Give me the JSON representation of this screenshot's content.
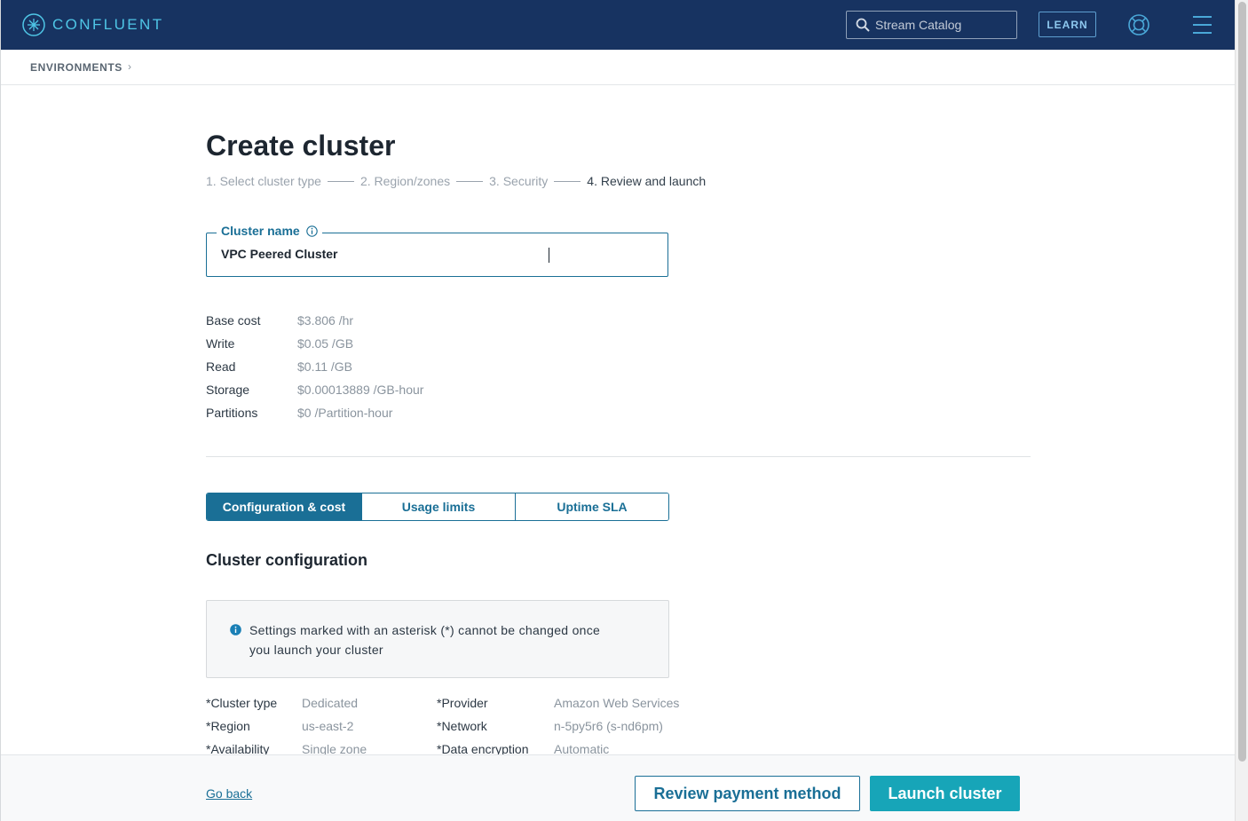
{
  "header": {
    "brand": "CONFLUENT",
    "search_placeholder": "Stream Catalog",
    "learn_label": "LEARN"
  },
  "breadcrumb": {
    "items": [
      "ENVIRONMENTS"
    ]
  },
  "page": {
    "title": "Create cluster",
    "steps": [
      {
        "label": "1. Select cluster type",
        "active": false
      },
      {
        "label": "2. Region/zones",
        "active": false
      },
      {
        "label": "3. Security",
        "active": false
      },
      {
        "label": "4. Review and launch",
        "active": true
      }
    ]
  },
  "cluster_name": {
    "label": "Cluster name",
    "value": "VPC Peered Cluster"
  },
  "costs": [
    {
      "label": "Base cost",
      "value": "$3.806 /hr"
    },
    {
      "label": "Write",
      "value": "$0.05 /GB"
    },
    {
      "label": "Read",
      "value": "$0.11 /GB"
    },
    {
      "label": "Storage",
      "value": "$0.00013889 /GB-hour"
    },
    {
      "label": "Partitions",
      "value": "$0 /Partition-hour"
    }
  ],
  "tabs": [
    {
      "label": "Configuration & cost",
      "active": true
    },
    {
      "label": "Usage limits",
      "active": false
    },
    {
      "label": "Uptime SLA",
      "active": false
    }
  ],
  "config": {
    "title": "Cluster configuration",
    "notice": "Settings marked with an asterisk (*) cannot be changed once you launch your cluster",
    "left": [
      {
        "label": "*Cluster type",
        "value": "Dedicated"
      },
      {
        "label": "*Region",
        "value": "us-east-2"
      },
      {
        "label": "*Availability",
        "value": "Single zone"
      }
    ],
    "right": [
      {
        "label": "*Provider",
        "value": "Amazon Web Services"
      },
      {
        "label": "*Network",
        "value": "n-5py5r6 (s-nd6pm)"
      },
      {
        "label": "*Data encryption",
        "value": "Automatic"
      }
    ]
  },
  "footer": {
    "go_back": "Go back",
    "review_payment": "Review payment method",
    "launch": "Launch cluster"
  },
  "colors": {
    "header_bg": "#173361",
    "accent": "#1a6f96",
    "launch": "#17a5b8"
  }
}
